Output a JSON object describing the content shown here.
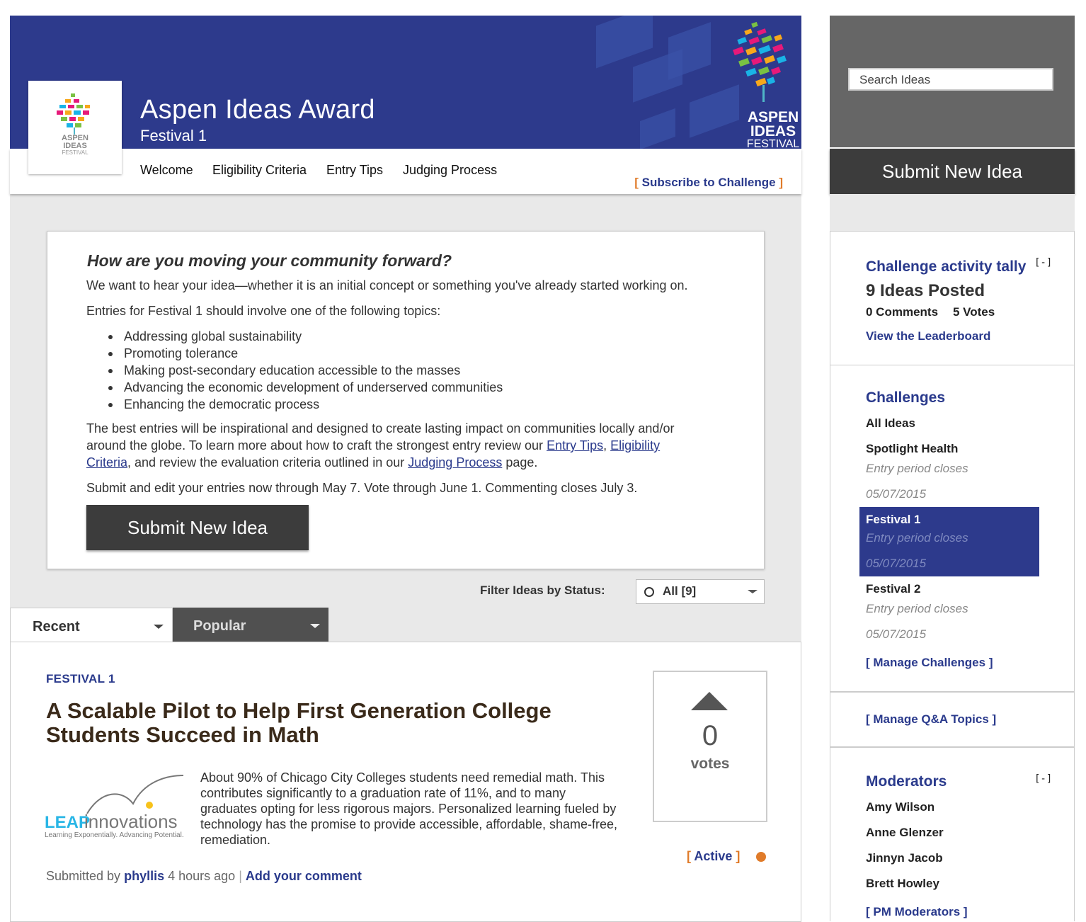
{
  "header": {
    "title": "Aspen Ideas Award",
    "subtitle": "Festival 1",
    "logo_lines": [
      "ASPEN",
      "IDEAS",
      "FESTIVAL"
    ],
    "nav": [
      "Welcome",
      "Eligibility Criteria",
      "Entry Tips",
      "Judging Process"
    ],
    "subscribe_label": "Subscribe to Challenge",
    "bracket_open": "[",
    "bracket_close": "]"
  },
  "intro": {
    "question": "How are you moving your community forward?",
    "p1": "We want to hear your idea—whether it is an initial concept or something you've already started working on.",
    "p2": "Entries for Festival 1 should involve one of the following topics:",
    "topics": [
      "Addressing global sustainability",
      "Promoting tolerance",
      "Making post-secondary education accessible to the masses",
      "Advancing the economic development of underserved communities",
      "Enhancing the democratic process"
    ],
    "p3_line1": "The best entries will be inspirational and designed to create lasting impact on communities locally and/or",
    "p3_line2_pre": "around the globe. To learn more about how to craft the strongest entry review our",
    "link_entry_tips": "Entry Tips",
    "comma": ",",
    "link_eligibility_1": "Eligibility",
    "link_eligibility_2": "Criteria",
    "p3_line3_mid": ", and review the evaluation criteria outlined in our",
    "link_judging": "Judging Process",
    "p3_line3_end": "page.",
    "p4": "Submit and edit your entries now through May 7. Vote through June 1. Commenting closes July 3.",
    "submit_label": "Submit New Idea"
  },
  "filter": {
    "label": "Filter Ideas by Status:",
    "selected": "All [9]"
  },
  "tabs": {
    "recent": "Recent",
    "popular": "Popular"
  },
  "idea": {
    "category": "FESTIVAL 1",
    "title": "A Scalable Pilot to Help First Generation College Students Succeed in Math",
    "image_brand": "LEAP",
    "image_brand2": "innovations",
    "image_tagline": "Learning Exponentially. Advancing Potential.",
    "description": "About 90% of Chicago City Colleges students need remedial math. This contributes significantly to a graduation rate of 11%, and to many graduates opting for less rigorous majors. Personalized learning fueled by technology has the promise to provide accessible, affordable, shame-free, remediation.",
    "votes": "0",
    "votes_label": "votes",
    "status": "Active",
    "submitted_by": "Submitted by",
    "author": "phyllis",
    "time": "4 hours ago",
    "separator": "|",
    "comment_link": "Add your comment"
  },
  "sidebar": {
    "search_placeholder": "Search Ideas",
    "submit_label": "Submit New Idea",
    "tally": {
      "heading": "Challenge activity tally",
      "toggle": "[-]",
      "ideas": "9 Ideas Posted",
      "comments": "0 Comments",
      "votes": "5 Votes",
      "leaderboard": "View the Leaderboard"
    },
    "challenges": {
      "heading": "Challenges",
      "all": "All Ideas",
      "items": [
        {
          "name": "Spotlight Health",
          "closes": "Entry period closes",
          "date": "05/07/2015"
        },
        {
          "name": "Festival 1",
          "closes": "Entry period closes",
          "date": "05/07/2015"
        },
        {
          "name": "Festival 2",
          "closes": "Entry period closes",
          "date": "05/07/2015"
        }
      ],
      "manage": "[ Manage Challenges ]"
    },
    "qa": {
      "manage": "[ Manage Q&A Topics ]"
    },
    "moderators": {
      "heading": "Moderators",
      "toggle": "[-]",
      "names": [
        "Amy Wilson",
        "Anne Glenzer",
        "Jinnyn Jacob",
        "Brett Howley"
      ],
      "pm": "[ PM Moderators ]"
    }
  },
  "colors": {
    "brand_blue": "#2d3a8c",
    "link_blue": "#2a3a8c",
    "accent_orange": "#e07b2a",
    "dark_button": "#3c3c3c"
  }
}
